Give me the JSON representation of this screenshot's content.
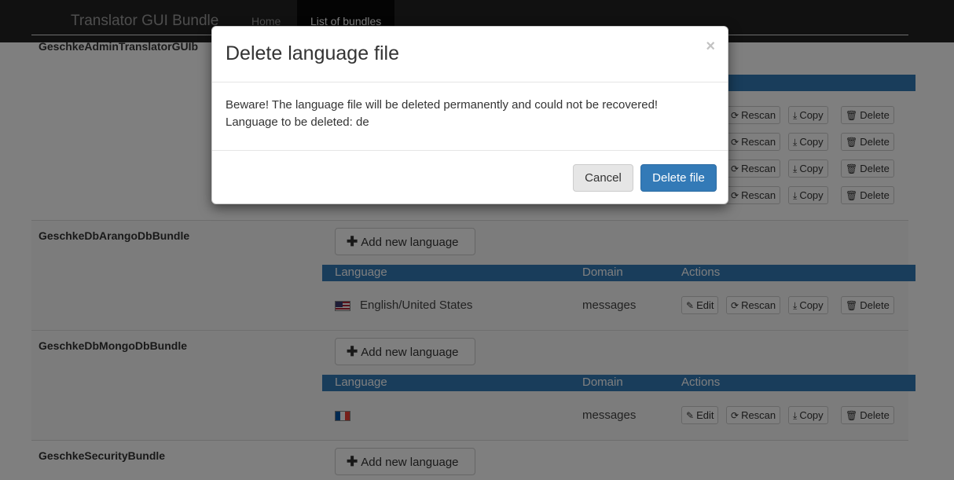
{
  "navbar": {
    "brand": "Translator GUI Bundle",
    "items": [
      {
        "label": "Home"
      },
      {
        "label": "List of bundles"
      }
    ]
  },
  "table_header": {
    "language": "Language",
    "domain": "Domain",
    "actions": "Actions"
  },
  "actions": {
    "edit": "Edit",
    "rescan": "Rescan",
    "copy": "Copy",
    "delete": "Delete"
  },
  "add_language_label": "Add new language",
  "bundles": [
    {
      "name": "GeschkeAdminTranslatorGUIBundle",
      "visible_name": "GeschkeAdminTranslatorGUIb",
      "rows": 4
    },
    {
      "name": "GeschkeDbArangoDbBundle",
      "rows": [
        {
          "flag": "us-flag-icon",
          "language": "English/United States",
          "domain": "messages"
        }
      ]
    },
    {
      "name": "GeschkeDbMongoDbBundle",
      "rows": [
        {
          "flag": "fr-flag-icon",
          "language": "",
          "domain": "messages"
        }
      ]
    },
    {
      "name": "GeschkeSecurityBundle",
      "rows": []
    }
  ],
  "modal": {
    "title": "Delete language file",
    "close_symbol": "×",
    "body_line1": "Beware! The language file will be deleted permanently and could not be recovered!",
    "body_line2": "Language to be deleted: de",
    "cancel_label": "Cancel",
    "confirm_label": "Delete file"
  },
  "colors": {
    "navbar": "#222222",
    "primary": "#337ab7",
    "backdrop": "rgba(0,0,0,0.5)"
  }
}
